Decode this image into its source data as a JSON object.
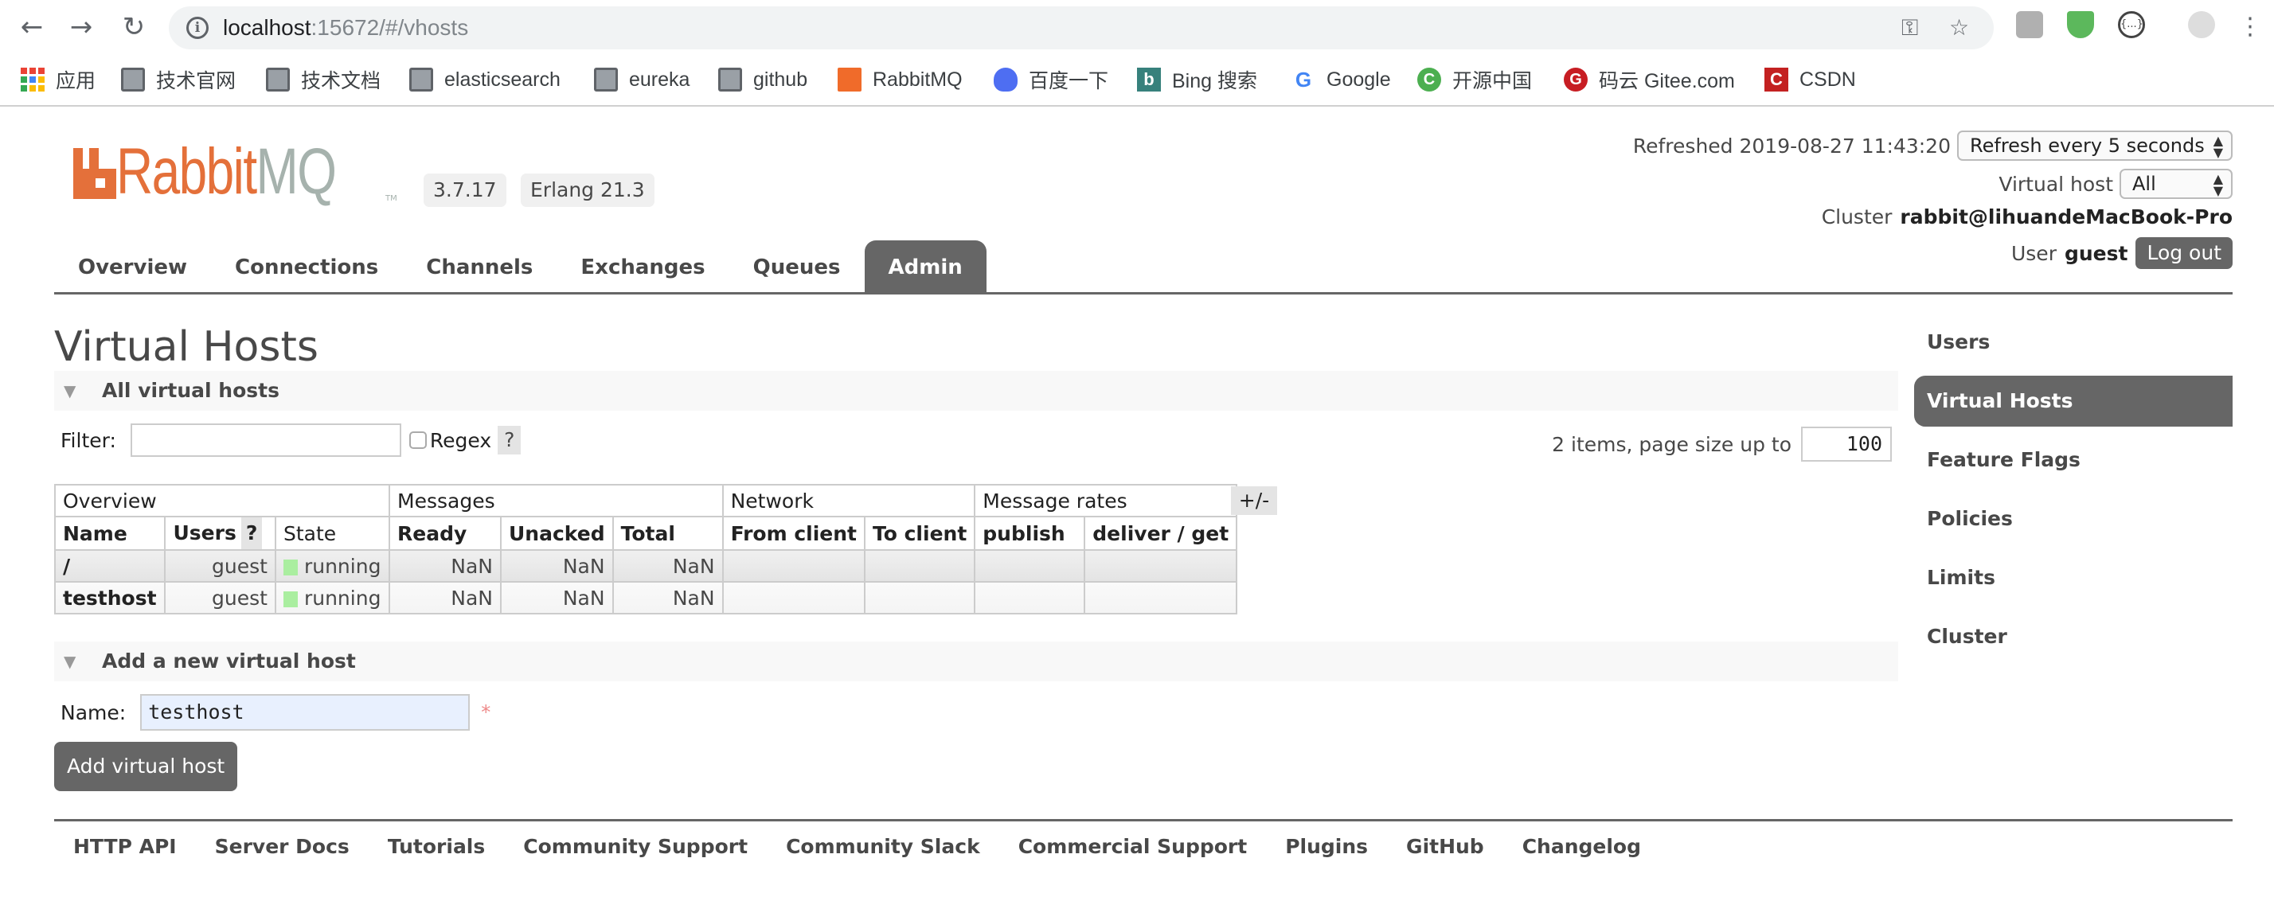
{
  "browser": {
    "url_host": "localhost",
    "url_path": ":15672/#/vhosts",
    "bookmarks": [
      {
        "label": "应用",
        "icon": "apps-grid-icon"
      },
      {
        "label": "技术官网",
        "icon": "folder-icon"
      },
      {
        "label": "技术文档",
        "icon": "folder-icon"
      },
      {
        "label": "elasticsearch",
        "icon": "folder-icon"
      },
      {
        "label": "eureka",
        "icon": "folder-icon"
      },
      {
        "label": "github",
        "icon": "folder-icon"
      },
      {
        "label": "RabbitMQ",
        "icon": "rabbitmq-icon"
      },
      {
        "label": "百度一下",
        "icon": "baidu-icon"
      },
      {
        "label": "Bing 搜索",
        "icon": "bing-icon"
      },
      {
        "label": "Google",
        "icon": "google-icon"
      },
      {
        "label": "开源中国",
        "icon": "oschina-icon"
      },
      {
        "label": "码云 Gitee.com",
        "icon": "gitee-icon"
      },
      {
        "label": "CSDN",
        "icon": "csdn-icon"
      }
    ]
  },
  "header": {
    "logo_text_rabbit": "Rabbit",
    "logo_text_mq": "MQ",
    "logo_tm": "TM",
    "version": "3.7.17",
    "erlang": "Erlang 21.3",
    "refreshed_label": "Refreshed 2019-08-27 11:43:20",
    "refresh_select": "Refresh every 5 seconds",
    "vhost_label": "Virtual host",
    "vhost_select": "All",
    "cluster_label": "Cluster",
    "cluster_name": "rabbit@lihuandeMacBook-Pro",
    "user_label": "User",
    "user_name": "guest",
    "logout": "Log out"
  },
  "tabs": [
    {
      "label": "Overview",
      "active": false
    },
    {
      "label": "Connections",
      "active": false
    },
    {
      "label": "Channels",
      "active": false
    },
    {
      "label": "Exchanges",
      "active": false
    },
    {
      "label": "Queues",
      "active": false
    },
    {
      "label": "Admin",
      "active": true
    }
  ],
  "main": {
    "title": "Virtual Hosts",
    "section_all": "All virtual hosts",
    "filter_label": "Filter:",
    "filter_value": "",
    "regex_label": "Regex",
    "help": "?",
    "paging_text": "2 items, page size up to",
    "page_size": "100",
    "plus_minus": "+/-",
    "table": {
      "groups": [
        "Overview",
        "Messages",
        "Network",
        "Message rates"
      ],
      "columns": [
        "Name",
        "Users",
        "State",
        "Ready",
        "Unacked",
        "Total",
        "From client",
        "To client",
        "publish",
        "deliver / get"
      ],
      "rows": [
        {
          "name": "/",
          "users": "guest",
          "state": "running",
          "ready": "NaN",
          "unacked": "NaN",
          "total": "NaN",
          "from_client": "",
          "to_client": "",
          "publish": "",
          "deliver_get": ""
        },
        {
          "name": "testhost",
          "users": "guest",
          "state": "running",
          "ready": "NaN",
          "unacked": "NaN",
          "total": "NaN",
          "from_client": "",
          "to_client": "",
          "publish": "",
          "deliver_get": ""
        }
      ]
    },
    "section_add": "Add a new virtual host",
    "name_label": "Name:",
    "name_value": "testhost",
    "required_mark": "*",
    "add_button": "Add virtual host"
  },
  "sidebar": {
    "items": [
      {
        "label": "Users",
        "active": false
      },
      {
        "label": "Virtual Hosts",
        "active": true
      },
      {
        "label": "Feature Flags",
        "active": false
      },
      {
        "label": "Policies",
        "active": false
      },
      {
        "label": "Limits",
        "active": false
      },
      {
        "label": "Cluster",
        "active": false
      }
    ]
  },
  "footer": {
    "links": [
      "HTTP API",
      "Server Docs",
      "Tutorials",
      "Community Support",
      "Community Slack",
      "Commercial Support",
      "Plugins",
      "GitHub",
      "Changelog"
    ]
  },
  "colors": {
    "brand_orange": "#e4703a",
    "brand_gray": "#a6b2ad",
    "active_tab": "#666666",
    "state_running": "#aaeea0"
  }
}
